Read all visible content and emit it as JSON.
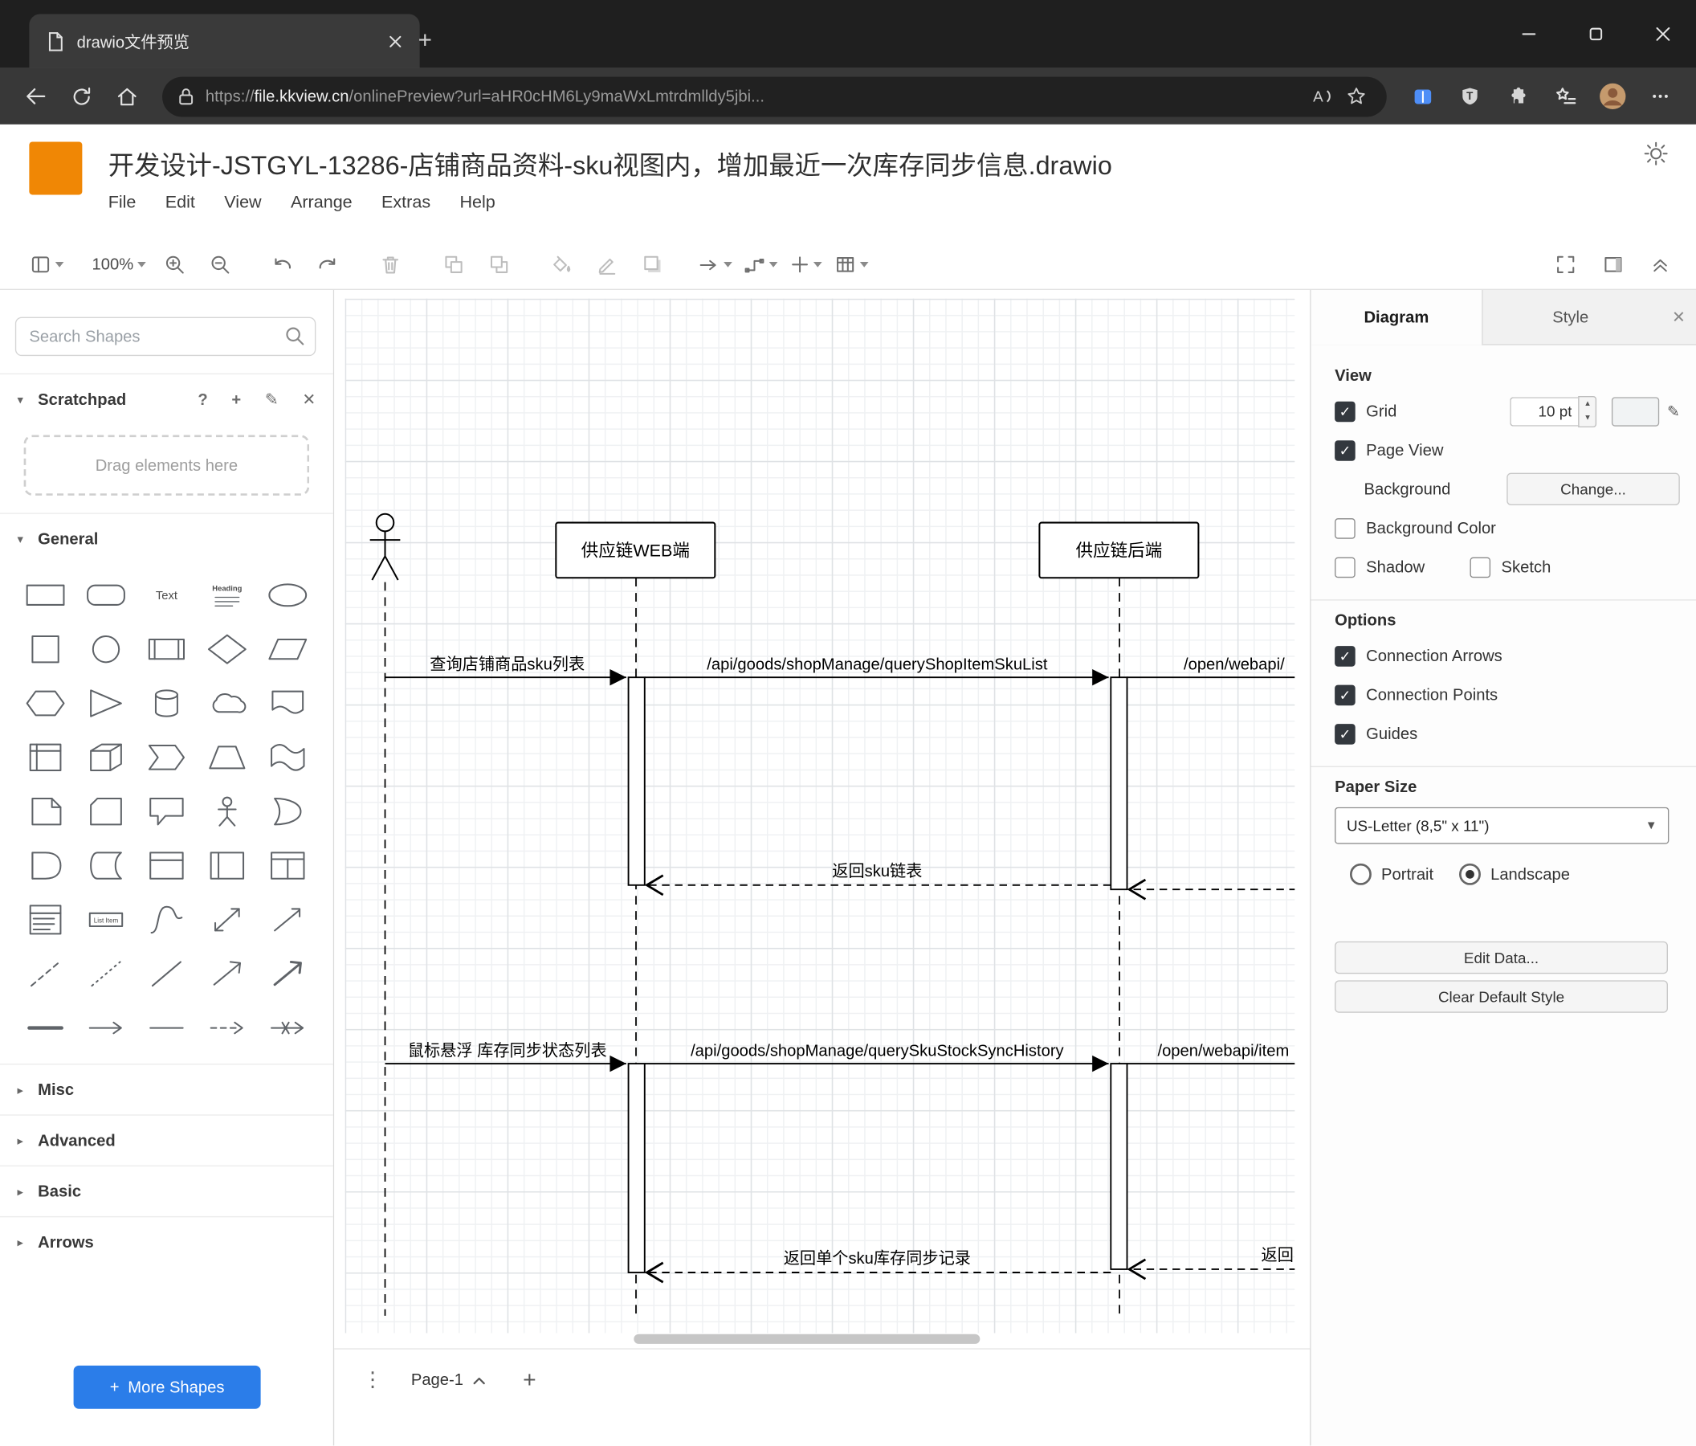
{
  "browser": {
    "tab_title": "drawio文件预览",
    "url_protocol": "https://",
    "url_host": "file.kkview.cn",
    "url_path": "/onlinePreview?url=aHR0cHM6Ly9maWxLmtrdmlldy5jbi..."
  },
  "app": {
    "title": "开发设计-JSTGYL-13286-店铺商品资料-sku视图内，增加最近一次库存同步信息.drawio",
    "menus": [
      "File",
      "Edit",
      "View",
      "Arrange",
      "Extras",
      "Help"
    ],
    "toolbar": {
      "zoom_level": "100%"
    }
  },
  "sidebar": {
    "search_placeholder": "Search Shapes",
    "scratchpad_label": "Scratchpad",
    "scratchpad_hint": "Drag elements here",
    "sections": {
      "general": "General",
      "misc": "Misc",
      "advanced": "Advanced",
      "basic": "Basic",
      "arrows": "Arrows"
    },
    "more_shapes_label": "More Shapes",
    "shapes": [
      "rectangle",
      "rounded-rectangle",
      "text",
      "heading",
      "ellipse",
      "square",
      "circle",
      "process",
      "diamond",
      "parallelogram",
      "hexagon",
      "triangle",
      "cylinder",
      "cloud",
      "document",
      "internal-storage",
      "cube",
      "step",
      "trapezoid",
      "tape",
      "note",
      "card",
      "callout",
      "actor",
      "or",
      "and",
      "data-storage",
      "container",
      "vertical-container",
      "horizontal-container",
      "list",
      "list-item",
      "curve",
      "bidirectional-arrow",
      "diagonal-arrow",
      "dashed-line",
      "dotted-line",
      "line",
      "arrow-up-right",
      "arrow-up-right-2",
      "bold-line",
      "horizontal-arrow",
      "horizontal-line",
      "dashed-arrow",
      "cross-arrow"
    ]
  },
  "canvas": {
    "participants": [
      "供应链WEB端",
      "供应链后端"
    ],
    "messages": {
      "m1": "查询店铺商品sku列表",
      "m2": "/api/goods/shopManage/queryShopItemSkuList",
      "m3": "/open/webapi/",
      "r1": "返回sku链表",
      "m4": "鼠标悬浮 库存同步状态列表",
      "m5": "/api/goods/shopManage/querySkuStockSyncHistory",
      "m6": "/open/webapi/item",
      "r2": "返回单个sku库存同步记录",
      "r3": "返回"
    }
  },
  "footer": {
    "page_tab": "Page-1"
  },
  "format_panel": {
    "tab_diagram": "Diagram",
    "tab_style": "Style",
    "view": {
      "title": "View",
      "grid_label": "Grid",
      "grid_size_value": "10 pt",
      "page_view_label": "Page View",
      "background_label": "Background",
      "change_button": "Change...",
      "background_color_label": "Background Color",
      "shadow_label": "Shadow",
      "sketch_label": "Sketch"
    },
    "options": {
      "title": "Options",
      "connection_arrows": "Connection Arrows",
      "connection_points": "Connection Points",
      "guides": "Guides"
    },
    "paper": {
      "title": "Paper Size",
      "size_value": "US-Letter (8,5\" x 11\")",
      "portrait": "Portrait",
      "landscape": "Landscape"
    },
    "edit_data_button": "Edit Data...",
    "clear_default_style_button": "Clear Default Style"
  },
  "colors": {
    "accent_blue": "#2b7de9",
    "drawio_orange": "#f08705",
    "checkbox_checked": "#33383e"
  }
}
